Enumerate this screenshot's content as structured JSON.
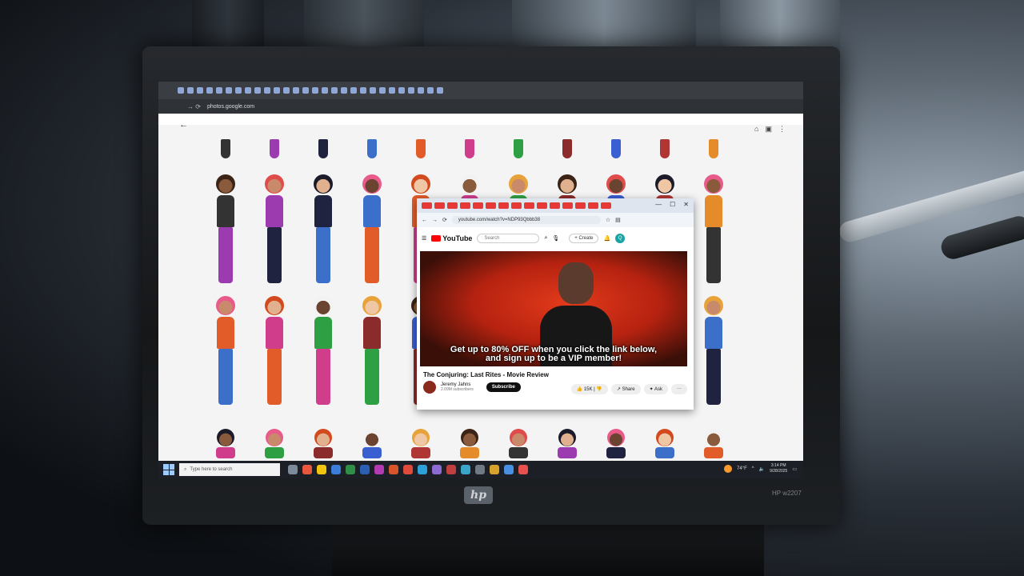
{
  "browser": {
    "url": "photos.google.com"
  },
  "youtube_window": {
    "url": "youtube.com/watch?v=NDP93Qbbb38",
    "logo": "YouTube",
    "search_placeholder": "Search",
    "create_label": "Create",
    "avatar_letter": "Q",
    "caption_line1": "Get up to 80% OFF when you click the link below,",
    "caption_line2": "and sign up to be a VIP member!",
    "video_title": "The Conjuring: Last Rites - Movie Review",
    "channel_name": "Jeremy Jahns",
    "subscribers": "2.09M subscribers",
    "subscribe_label": "Subscribe",
    "like_count": "15K",
    "share_label": "Share",
    "ask_label": "Ask",
    "more_label": "···"
  },
  "taskbar": {
    "search_placeholder": "Type here to search",
    "temperature": "74°F",
    "time": "3:14 PM",
    "date": "9/28/2025"
  },
  "monitor": {
    "brand": "hp",
    "model": "HP w2207"
  },
  "colors": {
    "outfits": [
      "#333333",
      "#9c3bb0",
      "#1f2340",
      "#3b6fc9",
      "#e25c2a",
      "#cf3d8b",
      "#2ea043",
      "#8b2b2b",
      "#3a5fd1",
      "#b03636",
      "#e58b2a"
    ]
  }
}
